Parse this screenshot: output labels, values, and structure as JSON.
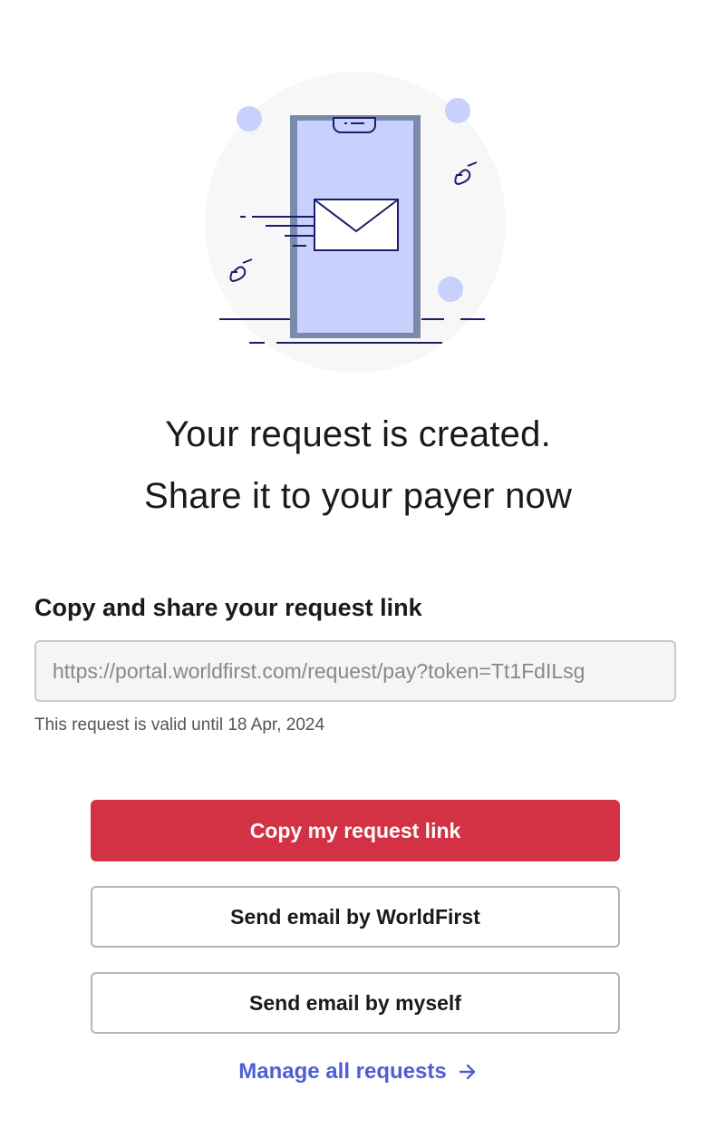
{
  "illustration": {
    "icon": "envelope-on-phone-illustration",
    "colors": {
      "circle_bg": "#f7f7f7",
      "phone_frame": "#7a8aab",
      "phone_screen": "#c8d1fb",
      "dots": "#c8d1fb",
      "lines": "#1c1c6b"
    }
  },
  "headline": {
    "line1": "Your request is created.",
    "line2": "Share it to your payer now"
  },
  "share_section": {
    "label": "Copy and share your request link",
    "link_value": "https://portal.worldfirst.com/request/pay?token=Tt1FdILsg",
    "validity_text": "This request is valid until 18 Apr, 2024"
  },
  "actions": {
    "copy_label": "Copy my request link",
    "email_worldfirst_label": "Send email by WorldFirst",
    "email_myself_label": "Send email by myself",
    "manage_label": "Manage all requests",
    "manage_icon": "arrow-right-icon"
  },
  "colors": {
    "primary": "#d33144",
    "link": "#4e5fd6",
    "border": "#b5b5b5"
  }
}
